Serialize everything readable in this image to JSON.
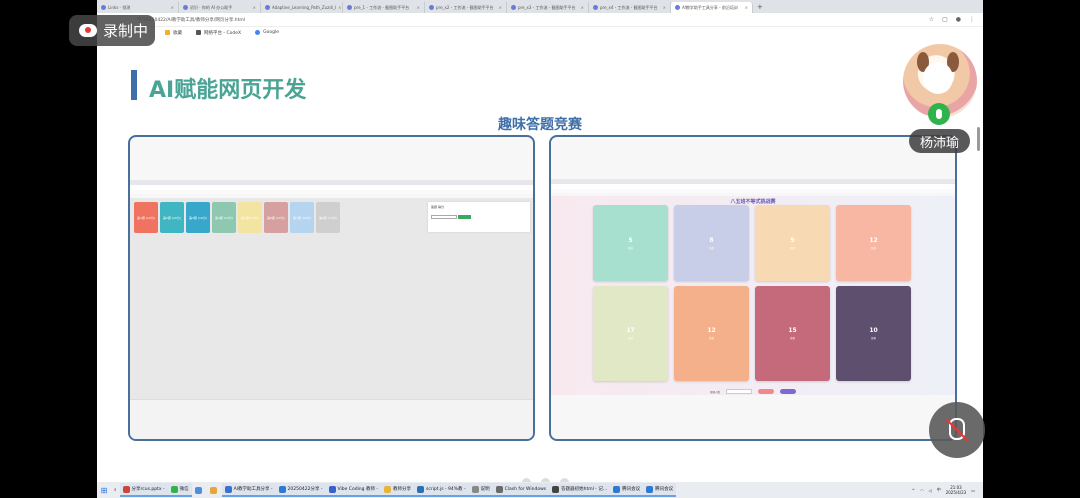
{
  "browser": {
    "tabs": [
      {
        "label": "Links - 领测"
      },
      {
        "label": "初识 · 你的 AI 办公助手"
      },
      {
        "label": "Adaptive_Learning_Path_Zuzdi_I"
      },
      {
        "label": "pre_1 - 工作流 - 截图助手平台"
      },
      {
        "label": "pre_x2 - 工作流 - 截图助手平台"
      },
      {
        "label": "pre_x3 - 工作流 - 截图助手平台"
      },
      {
        "label": "pre_x4 - 工作流 - 截图助手平台"
      },
      {
        "label": "AI教学助手工具分享 - 前沿培训"
      }
    ],
    "new_tab": "+",
    "address": "学/20250422/AI教学助工具/教师分享/网页分享.html",
    "bookmarks": [
      "收藏",
      "网络平台 - CodeX",
      "Google"
    ]
  },
  "slide": {
    "title": "AI赋能网页开发",
    "subtitle": "趣味答题竞赛",
    "board_title": "八五班不等式挑战赛",
    "cards_left": [
      {
        "label": "第1题 (10分)",
        "color": "#f07260"
      },
      {
        "label": "第2题 (10分)",
        "color": "#3fb6c2"
      },
      {
        "label": "第3题 (10分)",
        "color": "#37a8cc"
      },
      {
        "label": "第4题 (10分)",
        "color": "#8ec8b0"
      },
      {
        "label": "第5题 (10分)",
        "color": "#f3e4a2"
      },
      {
        "label": "第6题 (10分)",
        "color": "#d7a0a0"
      },
      {
        "label": "第7题 (10分)",
        "color": "#b4d4ef"
      },
      {
        "label": "第8题 (10分)",
        "color": "#cfcfcf"
      }
    ],
    "quiz_title": "答题 得分",
    "board_cards": [
      {
        "value": "5",
        "caption": "答题",
        "color": "#a8e0d0"
      },
      {
        "value": "8",
        "caption": "答题",
        "color": "#c8cde8"
      },
      {
        "value": "9",
        "caption": "答题",
        "color": "#f7d9b4"
      },
      {
        "value": "12",
        "caption": "答题",
        "color": "#f7b7a3"
      },
      {
        "value": "17",
        "caption": "答题",
        "color": "#e0e8c6"
      },
      {
        "value": "12",
        "caption": "答题",
        "color": "#f4b08a"
      },
      {
        "value": "15",
        "caption": "答题",
        "color": "#c56a7a"
      },
      {
        "value": "10",
        "caption": "答题",
        "color": "#5f4f6e"
      }
    ],
    "controls": {
      "label": "答题人数",
      "input": "请输入",
      "button1": "开始答题",
      "button2": "重置"
    }
  },
  "overlay": {
    "record_label": "录制中",
    "participant_name": "杨沛瑜"
  },
  "taskbar": {
    "items": [
      {
        "label": "分享rcus.pptx - ",
        "color": "#c9463a"
      },
      {
        "label": "微信",
        "color": "#2fb34a"
      },
      {
        "label": "",
        "color": "#4a8fe0"
      },
      {
        "label": "",
        "color": "#e6a53a"
      },
      {
        "label": "AI教学助工具分享 -",
        "color": "#3b6fd1"
      },
      {
        "label": "20250422分享 -",
        "color": "#2f7ad1"
      },
      {
        "label": "Vibe Coding 教师 -",
        "color": "#3a5fcf"
      },
      {
        "label": "教师分享",
        "color": "#e8b53a"
      },
      {
        "label": "script.js - 94%教 -",
        "color": "#2d6fb3"
      },
      {
        "label": "说明",
        "color": "#888888"
      },
      {
        "label": "Clash for Windows",
        "color": "#6a6a6a"
      },
      {
        "label": "答题器初始html - 记...",
        "color": "#444444"
      },
      {
        "label": "腾讯会议",
        "color": "#2f7ad1"
      },
      {
        "label": "腾讯会议",
        "color": "#2f7ad1"
      }
    ],
    "time": "21:03",
    "date": "2025/4/23",
    "lang": "中"
  }
}
